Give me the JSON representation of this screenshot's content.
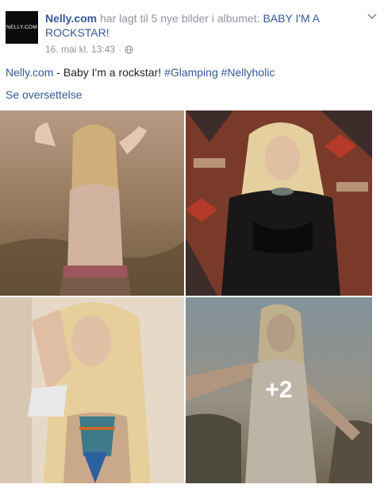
{
  "header": {
    "avatar_text": "NELLY.COM",
    "page_name": "Nelly.com",
    "action_text": " har lagt til 5 nye bilder i albumet: ",
    "album_name": "BABY I'M A ROCKSTAR!",
    "timestamp": "16. mai kl. 13:43",
    "separator": "·",
    "privacy_icon": "globe-icon",
    "menu_icon": "chevron-down-icon"
  },
  "post": {
    "page_link": "Nelly.com",
    "text": " - Baby I'm a rockstar! ",
    "hashtag1": "#Glamping",
    "hashtag2": "#Nellyholic",
    "translate_label": "Se oversettelse"
  },
  "photos": {
    "more_count": "+2"
  },
  "colors": {
    "link": "#365899",
    "meta": "#90949c",
    "text": "#1d2129"
  }
}
